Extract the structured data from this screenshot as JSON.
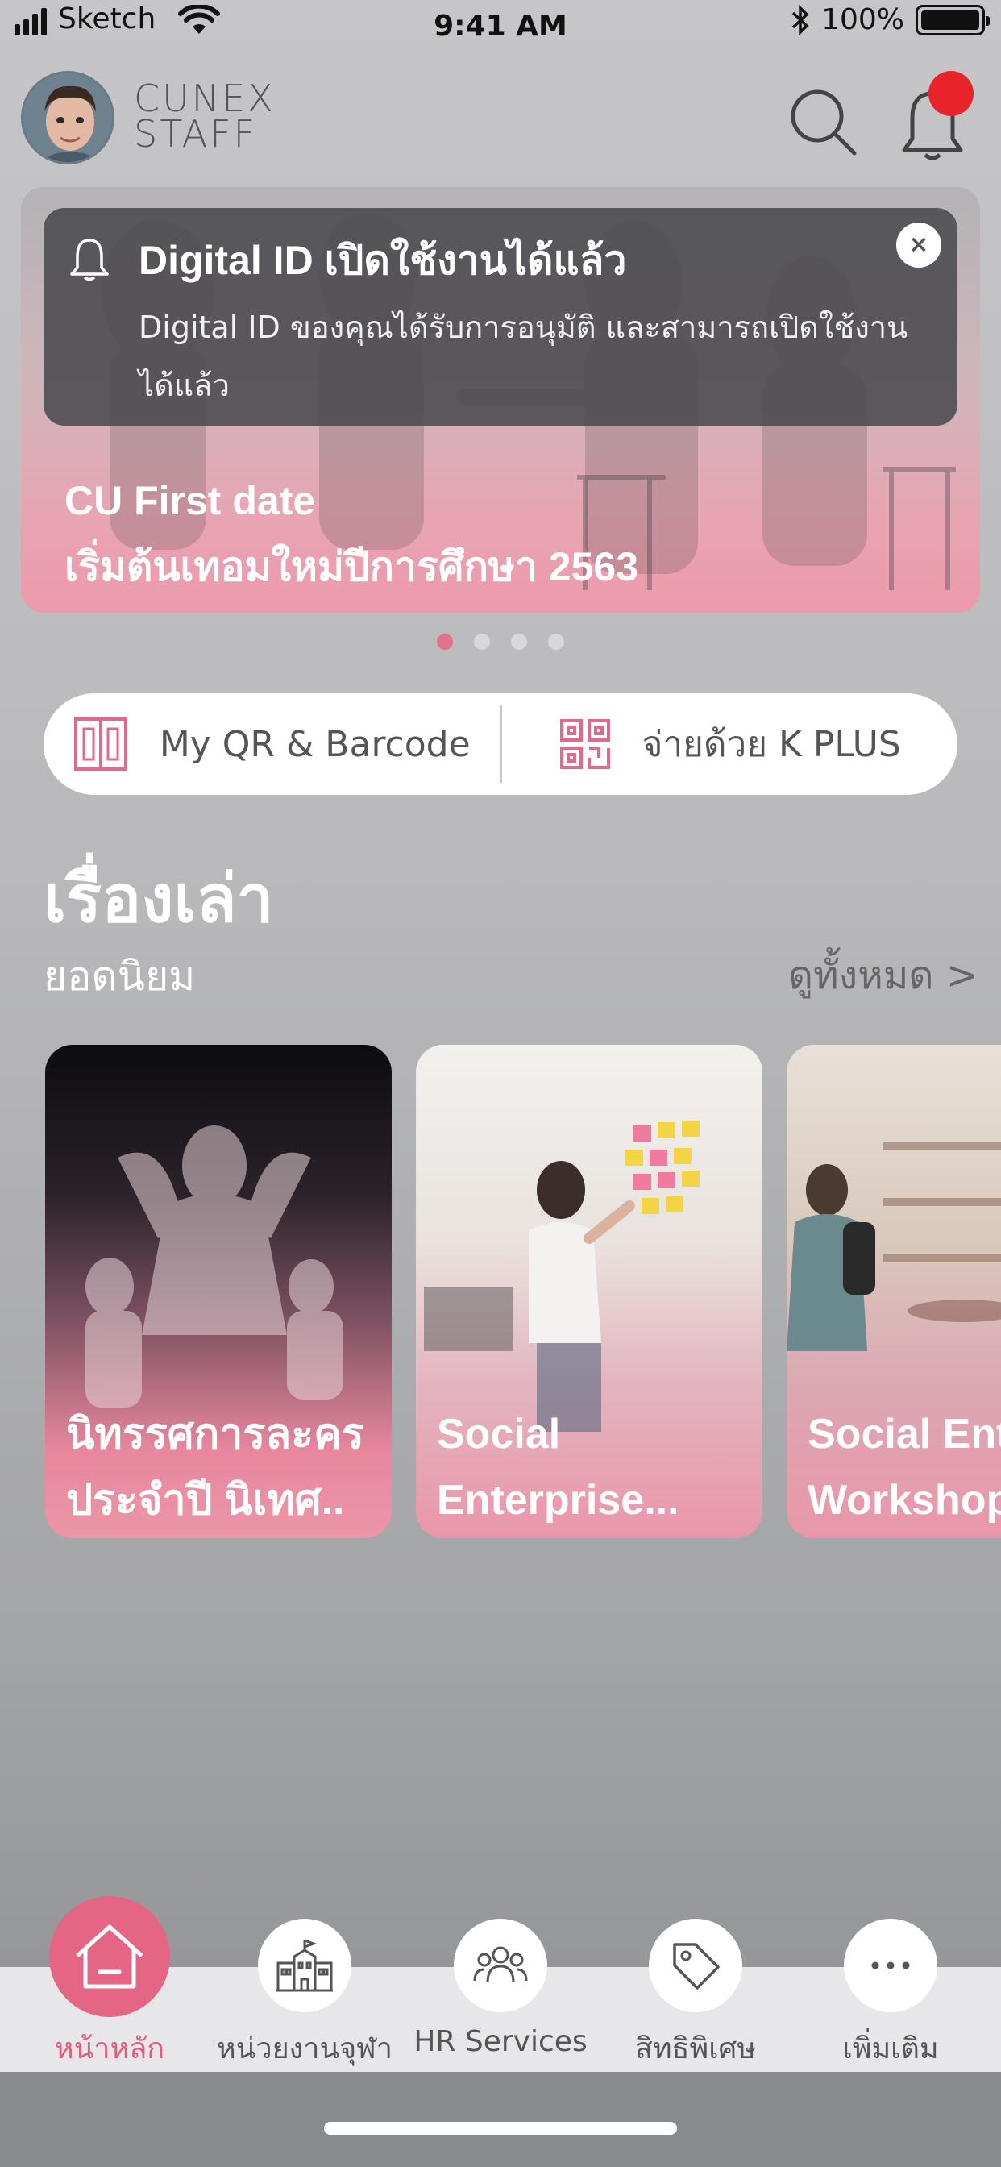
{
  "status_bar": {
    "carrier": "Sketch",
    "time": "9:41 AM",
    "battery": "100%"
  },
  "header": {
    "logo_line1": "CUNEX",
    "logo_line2": "STAFF",
    "icons": [
      "avatar",
      "search-icon",
      "bell-icon"
    ],
    "notification_dot_color": "#e8232a"
  },
  "banner": {
    "title_line1": "CU First date",
    "title_line2": "เริ่มต้นเทอมใหม่ปีการศึกษา 2563",
    "dots": {
      "count": 4,
      "active": 0
    }
  },
  "toast": {
    "title": "Digital ID เปิดใช้งานได้แล้ว",
    "body": "Digital ID ของคุณได้รับการอนุมัติ และสามารถเปิดใช้งานได้แล้ว",
    "close": "×"
  },
  "quick_actions": [
    {
      "label": "My QR & Barcode",
      "icon": "qr-card-icon"
    },
    {
      "label": "จ่ายด้วย K PLUS",
      "icon": "qr-code-icon"
    }
  ],
  "stories": {
    "title": "เรื่องเล่า",
    "subtitle": "ยอดนิยม",
    "see_all": "ดูทั้งหมด >",
    "cards": [
      {
        "title": "นิทรรศการละคร\nประจำปี นิเทศ.."
      },
      {
        "title": "Social\nEnterprise..."
      },
      {
        "title": "Social Ente\nWorkshop"
      }
    ]
  },
  "tabbar": {
    "items": [
      {
        "label": "หน้าหลัก",
        "icon": "home-icon",
        "active": true
      },
      {
        "label": "หน่วยงานจุฬา",
        "icon": "building-icon",
        "active": false
      },
      {
        "label": "HR Services",
        "icon": "people-icon",
        "active": false
      },
      {
        "label": "สิทธิพิเศษ",
        "icon": "tag-icon",
        "active": false
      },
      {
        "label": "เพิ่มเติม",
        "icon": "more-icon",
        "active": false
      }
    ]
  },
  "colors": {
    "accent_pink": "#e56585",
    "tab_active_text": "#e05d80"
  }
}
